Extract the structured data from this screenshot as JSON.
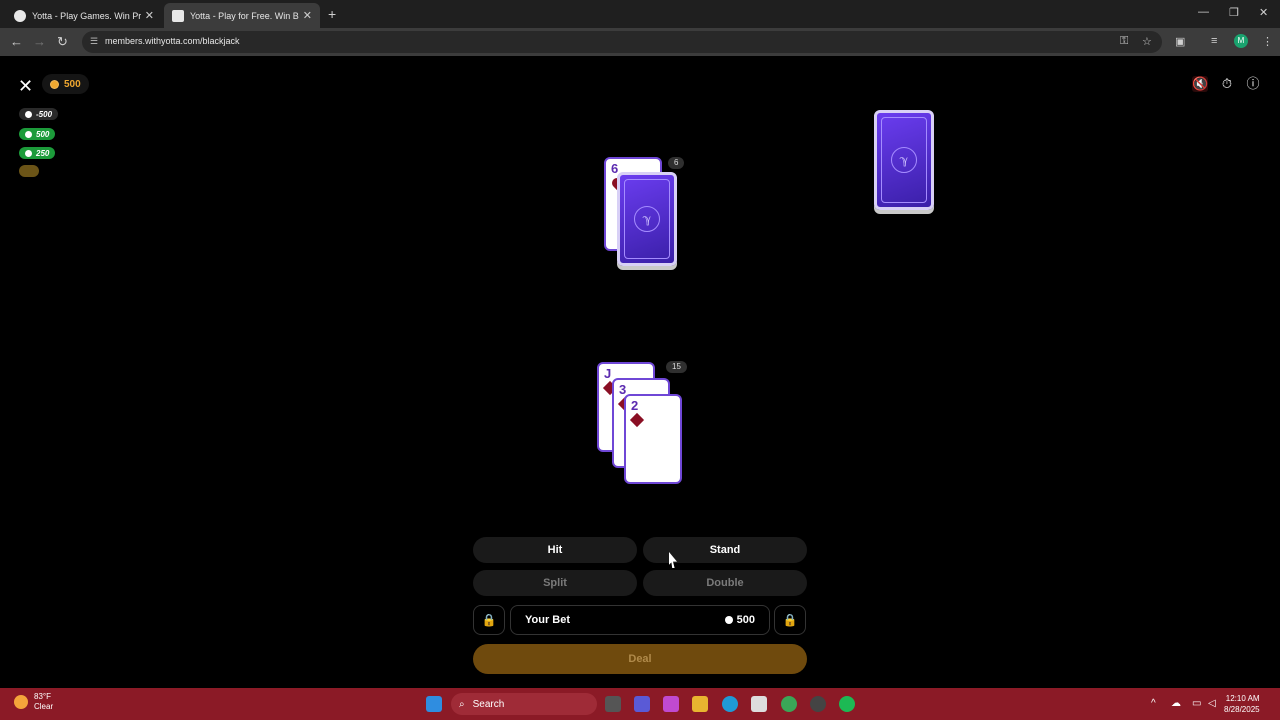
{
  "browser": {
    "tabs": [
      {
        "label": "Yotta - Play Games. Win Prizes"
      },
      {
        "label": "Yotta - Play for Free. Win Big"
      }
    ],
    "url": "members.withyotta.com/blackjack",
    "profile_initial": "M"
  },
  "game": {
    "balance": "500",
    "history": [
      "-500",
      "500",
      "250"
    ],
    "dealer_count": "6",
    "dealer_cards": [
      {
        "rank": "6",
        "suit": "hearts",
        "face": "up"
      },
      {
        "face": "down"
      }
    ],
    "player_count": "15",
    "player_cards": [
      {
        "rank": "J",
        "suit": "diamonds"
      },
      {
        "rank": "3",
        "suit": "diamonds"
      },
      {
        "rank": "2",
        "suit": "diamonds"
      }
    ],
    "actions": {
      "hit": "Hit",
      "stand": "Stand",
      "split": "Split",
      "double": "Double"
    },
    "bet": {
      "label": "Your Bet",
      "value": "500"
    },
    "deal_label": "Deal"
  },
  "taskbar": {
    "weather_temp": "83°F",
    "weather_desc": "Clear",
    "search_label": "Search",
    "time": "12:10 AM",
    "date": "8/28/2025"
  },
  "colors": {
    "accent_purple": "#6f47d6",
    "coin_gold": "#f0a830",
    "win_green": "#1c9b3a",
    "deal_brown": "#6f4a0d",
    "taskbar_red": "#8b1a26"
  }
}
